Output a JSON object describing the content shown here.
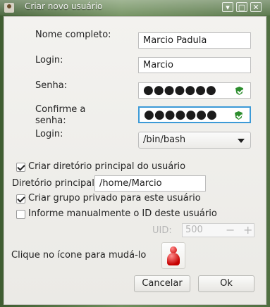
{
  "window": {
    "title": "Criar novo usuário",
    "controls": [
      "▾",
      "▢",
      "✕"
    ]
  },
  "form": {
    "full_name_label": "Nome completo:",
    "full_name_value": "Marcio Padula",
    "login_label": "Login:",
    "login_value": "Marcio",
    "password_label": "Senha:",
    "password_mask": "●●●●●●●",
    "confirm_label": "Confirme a senha:",
    "confirm_mask": "●●●●●●●",
    "shell_label": "Login:",
    "shell_value": "/bin/bash",
    "create_home_label": "Criar diretório principal do usuário",
    "home_dir_label": "Diretório principal",
    "home_dir_value": "/home/Marcio",
    "private_group_label": "Criar grupo privado para este usuário",
    "manual_uid_label": "Informe manualmente o ID deste usuário",
    "uid_label": "UID:",
    "uid_value": "500",
    "uid_minus": "−",
    "uid_plus": "+",
    "icon_label": "Clique no ícone para mudá-lo"
  },
  "buttons": {
    "cancel": "Cancelar",
    "ok": "Ok"
  },
  "icons": {
    "password_status_icon": "shield-check-icon",
    "confirm_status_icon": "shield-check-icon",
    "user_avatar": "red-user-icon"
  },
  "colors": {
    "window_background": "#ebeae6",
    "focus_border": "#3c9ad7",
    "shield_green": "#2c8d2d",
    "avatar_red": "#c90000"
  },
  "state": {
    "create_home_checked": true,
    "private_group_checked": true,
    "manual_uid_checked": false
  }
}
